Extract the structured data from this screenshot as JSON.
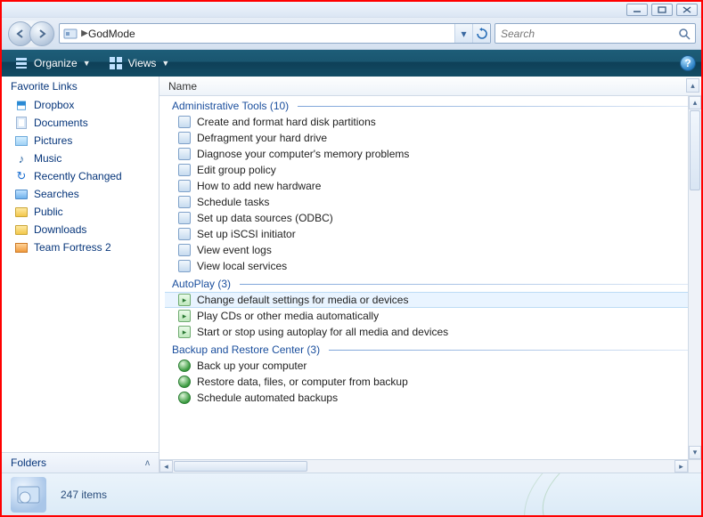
{
  "window": {
    "min_alt": "Minimize",
    "max_alt": "Maximize",
    "close_alt": "Close"
  },
  "address": {
    "location": "GodMode"
  },
  "search": {
    "placeholder": "Search"
  },
  "toolbar": {
    "organize": "Organize",
    "views": "Views"
  },
  "sidebar": {
    "favorites_header": "Favorite Links",
    "items": [
      {
        "label": "Dropbox",
        "icon": "dropbox"
      },
      {
        "label": "Documents",
        "icon": "doc"
      },
      {
        "label": "Pictures",
        "icon": "pic"
      },
      {
        "label": "Music",
        "icon": "music"
      },
      {
        "label": "Recently Changed",
        "icon": "sync"
      },
      {
        "label": "Searches",
        "icon": "search"
      },
      {
        "label": "Public",
        "icon": "folder"
      },
      {
        "label": "Downloads",
        "icon": "folder"
      },
      {
        "label": "Team Fortress 2",
        "icon": "tf2"
      }
    ],
    "folders_header": "Folders"
  },
  "columns": {
    "name": "Name"
  },
  "groups": [
    {
      "title": "Administrative Tools",
      "count": 10,
      "icon": "cp",
      "items": [
        "Create and format hard disk partitions",
        "Defragment your hard drive",
        "Diagnose your computer's memory problems",
        "Edit group policy",
        "How to add new hardware",
        "Schedule tasks",
        "Set up data sources (ODBC)",
        "Set up iSCSI initiator",
        "View event logs",
        "View local services"
      ]
    },
    {
      "title": "AutoPlay",
      "count": 3,
      "icon": "ap",
      "selected": 0,
      "items": [
        "Change default settings for media or devices",
        "Play CDs or other media automatically",
        "Start or stop using autoplay for all media and devices"
      ]
    },
    {
      "title": "Backup and Restore Center",
      "count": 3,
      "icon": "bu",
      "items": [
        "Back up your computer",
        "Restore data, files, or computer from backup",
        "Schedule automated backups"
      ]
    }
  ],
  "status": {
    "text": "247 items"
  }
}
